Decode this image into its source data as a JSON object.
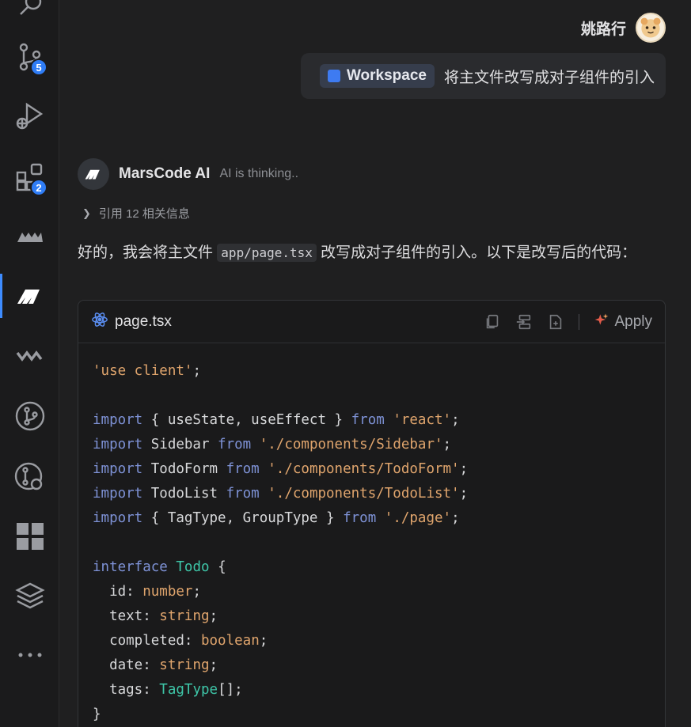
{
  "activity_bar": {
    "source_control_badge": "5",
    "extensions_badge": "2"
  },
  "user": {
    "name": "姚路行"
  },
  "user_message": {
    "workspace_chip": "Workspace",
    "text": "将主文件改写成对子组件的引入"
  },
  "ai": {
    "name": "MarsCode AI",
    "status": "AI is thinking..",
    "reference": "引用 12 相关信息",
    "intro_before": "好的，我会将主文件",
    "intro_code": "app/page.tsx",
    "intro_after": "改写成对子组件的引入。以下是改写后的代码："
  },
  "code_block": {
    "filename": "page.tsx",
    "apply_label": "Apply",
    "lines": [
      [
        {
          "t": "'use client'",
          "c": "str"
        },
        {
          "t": ";",
          "c": "pl"
        }
      ],
      [],
      [
        {
          "t": "import",
          "c": "kw"
        },
        {
          "t": " { useState, useEffect } ",
          "c": "id"
        },
        {
          "t": "from",
          "c": "kw"
        },
        {
          "t": " 'react'",
          "c": "str"
        },
        {
          "t": ";",
          "c": "pl"
        }
      ],
      [
        {
          "t": "import",
          "c": "kw"
        },
        {
          "t": " Sidebar ",
          "c": "id"
        },
        {
          "t": "from",
          "c": "kw"
        },
        {
          "t": " './components/Sidebar'",
          "c": "str"
        },
        {
          "t": ";",
          "c": "pl"
        }
      ],
      [
        {
          "t": "import",
          "c": "kw"
        },
        {
          "t": " TodoForm ",
          "c": "id"
        },
        {
          "t": "from",
          "c": "kw"
        },
        {
          "t": " './components/TodoForm'",
          "c": "str"
        },
        {
          "t": ";",
          "c": "pl"
        }
      ],
      [
        {
          "t": "import",
          "c": "kw"
        },
        {
          "t": " TodoList ",
          "c": "id"
        },
        {
          "t": "from",
          "c": "kw"
        },
        {
          "t": " './components/TodoList'",
          "c": "str"
        },
        {
          "t": ";",
          "c": "pl"
        }
      ],
      [
        {
          "t": "import",
          "c": "kw"
        },
        {
          "t": " { TagType, GroupType } ",
          "c": "id"
        },
        {
          "t": "from",
          "c": "kw"
        },
        {
          "t": " './page'",
          "c": "str"
        },
        {
          "t": ";",
          "c": "pl"
        }
      ],
      [],
      [
        {
          "t": "interface",
          "c": "kw"
        },
        {
          "t": " ",
          "c": "pl"
        },
        {
          "t": "Todo",
          "c": "iface"
        },
        {
          "t": " {",
          "c": "pl"
        }
      ],
      [
        {
          "t": "  id",
          "c": "prop"
        },
        {
          "t": ": ",
          "c": "pl"
        },
        {
          "t": "number",
          "c": "type"
        },
        {
          "t": ";",
          "c": "pl"
        }
      ],
      [
        {
          "t": "  text",
          "c": "prop"
        },
        {
          "t": ": ",
          "c": "pl"
        },
        {
          "t": "string",
          "c": "type"
        },
        {
          "t": ";",
          "c": "pl"
        }
      ],
      [
        {
          "t": "  completed",
          "c": "prop"
        },
        {
          "t": ": ",
          "c": "pl"
        },
        {
          "t": "boolean",
          "c": "type"
        },
        {
          "t": ";",
          "c": "pl"
        }
      ],
      [
        {
          "t": "  date",
          "c": "prop"
        },
        {
          "t": ": ",
          "c": "pl"
        },
        {
          "t": "string",
          "c": "type"
        },
        {
          "t": ";",
          "c": "pl"
        }
      ],
      [
        {
          "t": "  tags",
          "c": "prop"
        },
        {
          "t": ": ",
          "c": "pl"
        },
        {
          "t": "TagType",
          "c": "iface"
        },
        {
          "t": "[];",
          "c": "pl"
        }
      ],
      [
        {
          "t": "}",
          "c": "pl"
        }
      ]
    ]
  },
  "colors": {
    "keyword": "#7e92d6",
    "string": "#e0a56d",
    "interface_name": "#3ec6a8",
    "accent": "#2f7df6"
  }
}
